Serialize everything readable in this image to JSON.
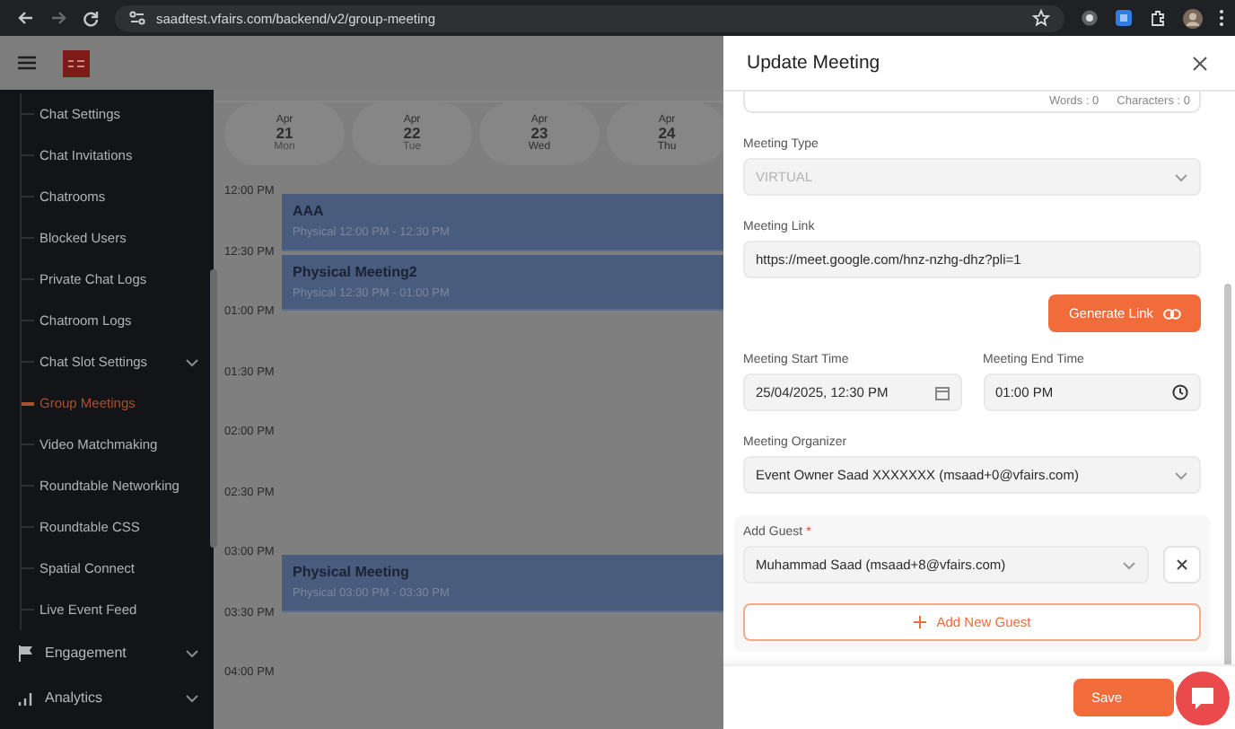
{
  "browser": {
    "url": "saadtest.vfairs.com/backend/v2/group-meeting"
  },
  "sidebar": {
    "items": [
      {
        "label": "Chat Settings",
        "selected": false,
        "expandable": false
      },
      {
        "label": "Chat Invitations",
        "selected": false,
        "expandable": false
      },
      {
        "label": "Chatrooms",
        "selected": false,
        "expandable": false
      },
      {
        "label": "Blocked Users",
        "selected": false,
        "expandable": false
      },
      {
        "label": "Private Chat Logs",
        "selected": false,
        "expandable": false
      },
      {
        "label": "Chatroom Logs",
        "selected": false,
        "expandable": false
      },
      {
        "label": "Chat Slot Settings",
        "selected": false,
        "expandable": true
      },
      {
        "label": "Group Meetings",
        "selected": true,
        "expandable": false
      },
      {
        "label": "Video Matchmaking",
        "selected": false,
        "expandable": false
      },
      {
        "label": "Roundtable Networking",
        "selected": false,
        "expandable": false
      },
      {
        "label": "Roundtable CSS",
        "selected": false,
        "expandable": false
      },
      {
        "label": "Spatial Connect",
        "selected": false,
        "expandable": false
      },
      {
        "label": "Live Event Feed",
        "selected": false,
        "expandable": false
      }
    ],
    "sections": [
      {
        "label": "Engagement",
        "kind": "flag"
      },
      {
        "label": "Analytics",
        "kind": "chart"
      }
    ]
  },
  "calendar": {
    "days": [
      {
        "month": "Apr",
        "day": "21",
        "weekday": "Mon",
        "past": true
      },
      {
        "month": "Apr",
        "day": "22",
        "weekday": "Tue",
        "past": true
      },
      {
        "month": "Apr",
        "day": "23",
        "weekday": "Wed",
        "past": false
      },
      {
        "month": "Apr",
        "day": "24",
        "weekday": "Thu",
        "past": false
      }
    ],
    "slots": [
      {
        "time": "12:00 PM",
        "events": [
          {
            "title": "AAA",
            "detail": "Physical 12:00 PM - 12:30 PM"
          }
        ]
      },
      {
        "time": "12:30 PM",
        "events": [
          {
            "title": "Physical Meeting2",
            "detail": "Physical 12:30 PM - 01:00 PM"
          }
        ]
      },
      {
        "time": "01:00 PM"
      },
      {
        "time": "01:30 PM"
      },
      {
        "time": "02:00 PM"
      },
      {
        "time": "02:30 PM"
      },
      {
        "time": "03:00 PM",
        "events": [
          {
            "title": "Physical Meeting",
            "detail": "Physical 03:00 PM - 03:30 PM"
          }
        ]
      },
      {
        "time": "03:30 PM"
      },
      {
        "time": "04:00 PM"
      }
    ]
  },
  "drawer": {
    "title": "Update Meeting",
    "counter": {
      "words": "Words : 0",
      "characters": "Characters : 0"
    },
    "meeting_type": {
      "label": "Meeting Type",
      "value": "VIRTUAL",
      "disabled": true
    },
    "meeting_link": {
      "label": "Meeting Link",
      "value": "https://meet.google.com/hnz-nzhg-dhz?pli=1"
    },
    "generate_button": "Generate Link",
    "start_time": {
      "label": "Meeting Start Time",
      "value": "25/04/2025, 12:30 PM"
    },
    "end_time": {
      "label": "Meeting End Time",
      "value": "01:00 PM"
    },
    "organizer": {
      "label": "Meeting Organizer",
      "value": "Event Owner Saad XXXXXXX (msaad+0@vfairs.com)"
    },
    "guests": {
      "label": "Add Guest",
      "required": "*",
      "items": [
        {
          "value": "Muhammad Saad (msaad+8@vfairs.com)"
        }
      ],
      "add_button": "Add New Guest"
    },
    "save_button": "Save"
  }
}
